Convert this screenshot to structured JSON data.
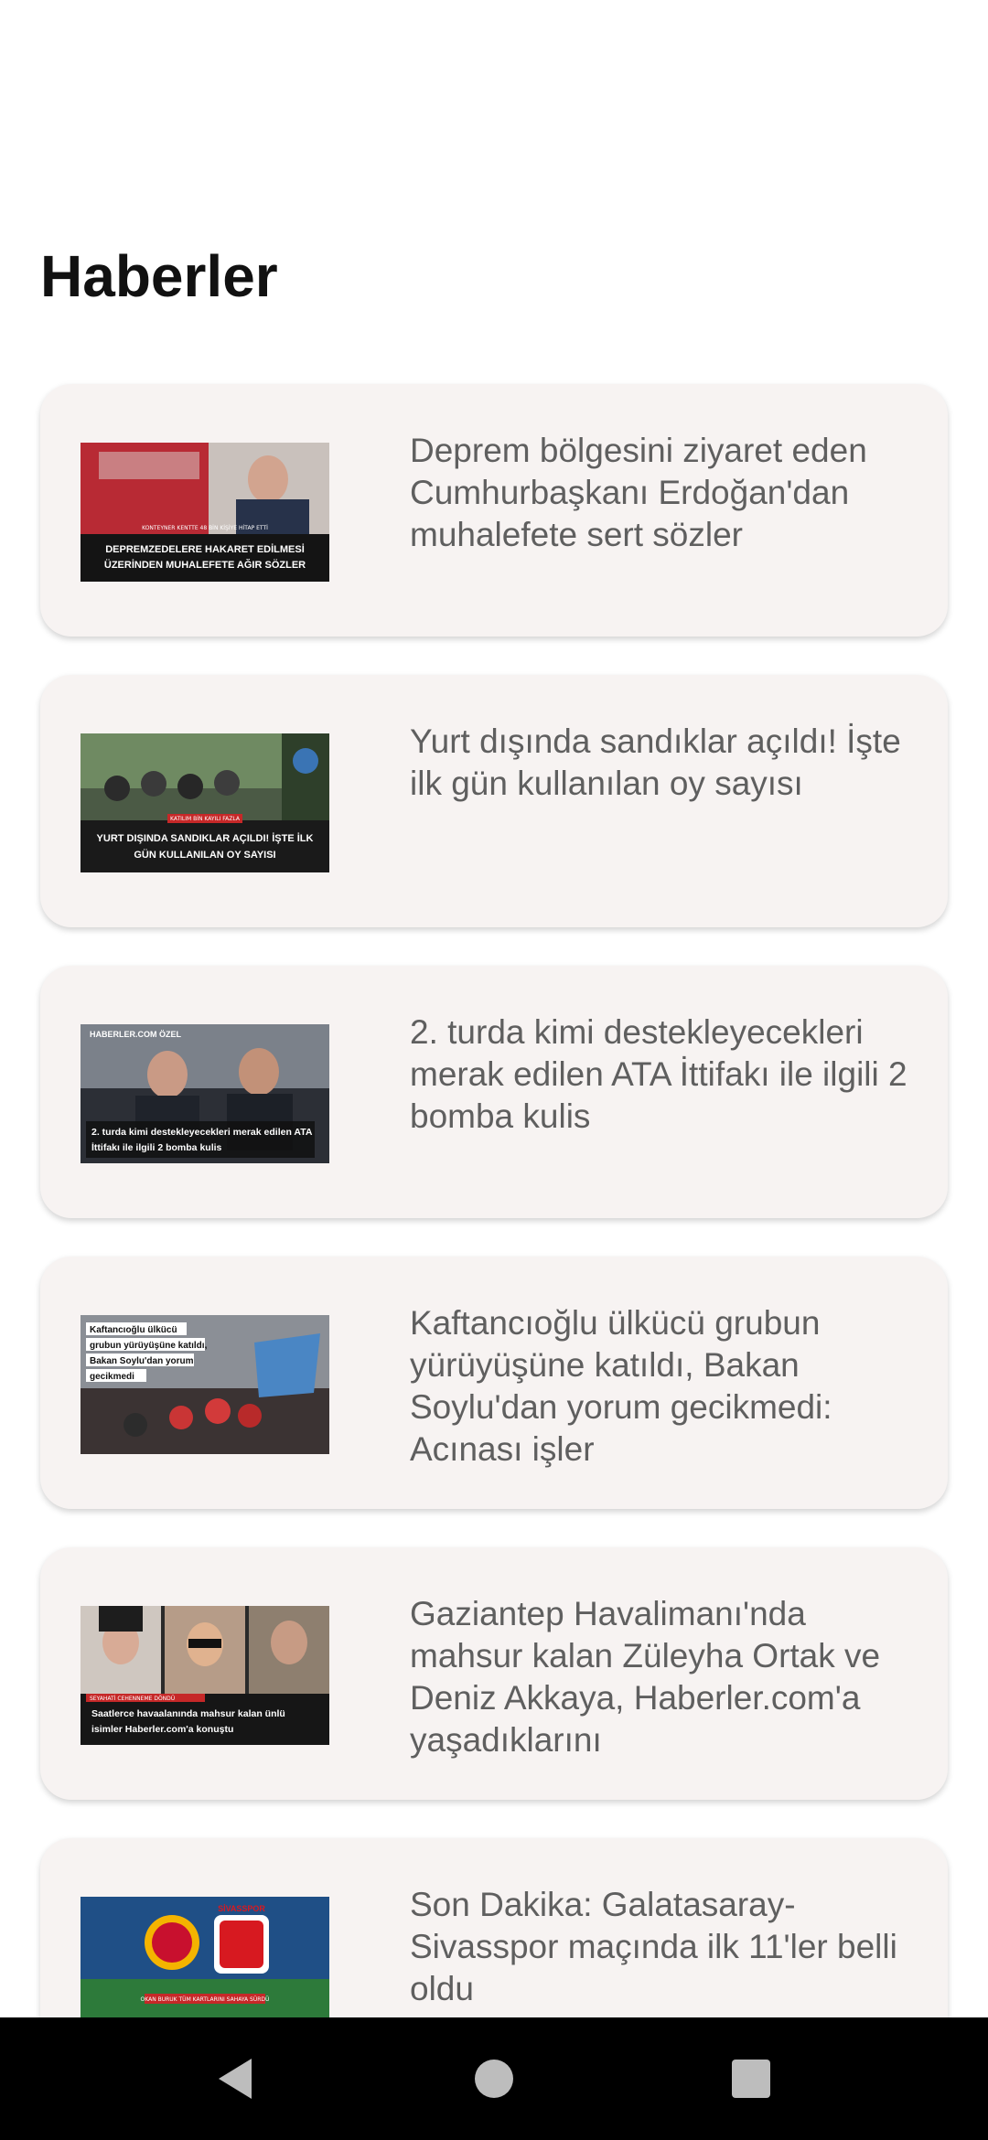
{
  "page": {
    "title": "Haberler"
  },
  "news": [
    {
      "title": "Deprem bölgesini ziyaret eden Cumhurbaşkanı Erdoğan'dan muhalefete sert sözler",
      "thumb_kicker": "KONTEYNER KENTTE 48 BİN KİŞİYE HİTAP ETTİ",
      "thumb_headline_1": "DEPREMZEDELERE HAKARET EDİLMESİ",
      "thumb_headline_2": "ÜZERİNDEN MUHALEFETE AĞIR SÖZLER"
    },
    {
      "title": "Yurt dışında sandıklar açıldı! İşte ilk gün kullanılan oy sayısı",
      "thumb_kicker": "KATILIM BİN KAYILI FAZLA",
      "thumb_headline_1": "YURT DIŞINDA SANDIKLAR AÇILDI! İŞTE İLK",
      "thumb_headline_2": "GÜN KULLANILAN OY SAYISI"
    },
    {
      "title": "2. turda kimi destekleyecekleri merak edilen ATA İttifakı ile ilgili 2 bomba kulis",
      "thumb_kicker": "HABERLER.COM ÖZEL",
      "thumb_headline_1": "2. turda kimi destekleyecekleri merak edilen ATA",
      "thumb_headline_2": "İttifakı ile ilgili 2 bomba kulis"
    },
    {
      "title": "Kaftancıoğlu ülkücü grubun yürüyüşüne katıldı, Bakan Soylu'dan yorum gecikmedi: Acınası işler",
      "thumb_lines": [
        "Kaftancıoğlu ülkücü",
        "grubun yürüyüşüne katıldı,",
        "Bakan Soylu'dan yorum",
        "gecikmedi"
      ]
    },
    {
      "title": "Gaziantep Havalimanı'nda mahsur kalan Züleyha Ortak ve Deniz Akkaya, Haberler.com'a yaşadıklarını",
      "thumb_kicker": "SEYAHATİ CEHENNEME DÖNDÜ",
      "thumb_headline_1": "Saatlerce havaalanında mahsur kalan ünlü",
      "thumb_headline_2": "isimler Haberler.com'a konuştu"
    },
    {
      "title": "Son Dakika: Galatasaray-Sivasspor maçında ilk 11'ler belli oldu",
      "thumb_kicker": "SİVASSPOR",
      "thumb_headline_1": "OKAN BURUK TÜM KARTLARINI SAHAYA SÜRDÜ"
    }
  ],
  "colors": {
    "card_bg": "#f7f3f2",
    "title_text": "#111111",
    "card_text": "#5f5f5f",
    "nav_bg": "#000000",
    "nav_icon": "#bdbdbd"
  },
  "nav": {
    "back_icon": "back-triangle-icon",
    "home_icon": "home-circle-icon",
    "recents_icon": "recents-square-icon"
  }
}
